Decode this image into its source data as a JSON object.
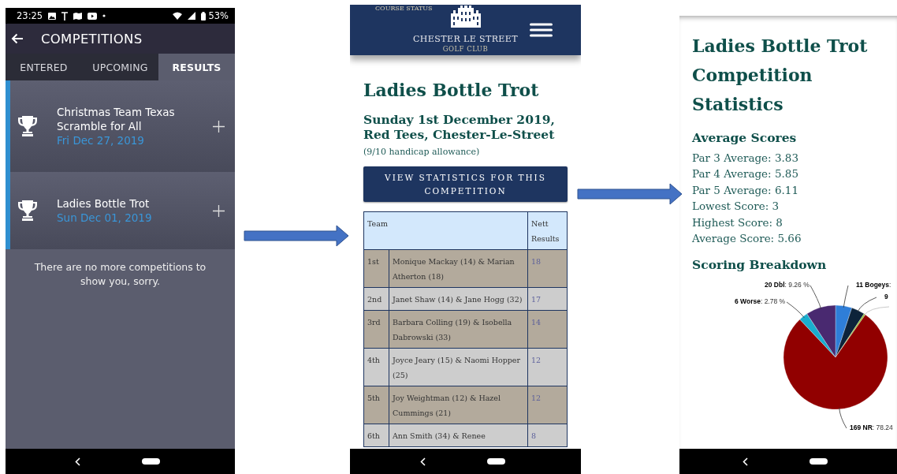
{
  "app_screen": {
    "status_bar": {
      "time": "23:25",
      "battery": "53%"
    },
    "app_bar": {
      "title": "COMPETITIONS"
    },
    "tabs": [
      {
        "label": "ENTERED",
        "selected": false
      },
      {
        "label": "UPCOMING",
        "selected": false
      },
      {
        "label": "RESULTS",
        "selected": true
      }
    ],
    "competitions": [
      {
        "name": "Christmas Team Texas Scramble for All",
        "date": "Fri Dec 27, 2019"
      },
      {
        "name": "Ladies Bottle Trot",
        "date": "Sun Dec 01, 2019"
      }
    ],
    "empty_message": "There are no more competitions to show you, sorry."
  },
  "results_page": {
    "header": {
      "course_status": "COURSE STATUS",
      "club_name": "CHESTER LE STREET",
      "club_subtitle": "GOLF CLUB"
    },
    "title": "Ladies Bottle Trot",
    "subtitle": "Sunday 1st December 2019, Red Tees, Chester-Le-Street",
    "note": "(9/10 handicap allowance)",
    "stats_button": "VIEW STATISTICS FOR THIS COMPETITION",
    "table": {
      "columns": [
        "Team",
        "Nett Results"
      ],
      "rows": [
        {
          "position": "1st",
          "team": "Monique Mackay (14) & Marian Atherton (18)",
          "result": "18"
        },
        {
          "position": "2nd",
          "team": "Janet Shaw (14) & Jane Hogg (32)",
          "result": "17"
        },
        {
          "position": "3rd",
          "team": "Barbara Colling (19) & Isobella Dabrowski (33)",
          "result": "14"
        },
        {
          "position": "4th",
          "team": "Joyce Jeary (15) & Naomi Hopper (25)",
          "result": "12"
        },
        {
          "position": "5th",
          "team": "Joy Weightman (12) & Hazel Cummings (21)",
          "result": "12"
        },
        {
          "position": "6th",
          "team": "Ann Smith (34) & Renee",
          "result": "8"
        }
      ]
    }
  },
  "statistics_page": {
    "title": "Ladies Bottle Trot Competition Statistics",
    "averages_heading": "Average Scores",
    "averages": [
      "Par 3 Average: 3.83",
      "Par 4 Average: 5.85",
      "Par 5 Average: 6.11",
      "Lowest Score: 3",
      "Highest Score: 8",
      "Average Score: 5.66"
    ],
    "breakdown_heading": "Scoring Breakdown",
    "chart_data": {
      "type": "pie",
      "values": [
        11,
        9,
        1,
        169,
        6,
        20
      ],
      "colors": [
        "#2f7ed8",
        "#0d233a",
        "#8bbc21",
        "#910000",
        "#1aadce",
        "#492970"
      ],
      "value_labels": [
        "**11 Bogeys**:",
        "**9**",
        null,
        "**169 NR**: 78.24",
        "**6 Worse**: 2.78 %",
        "**20 Dbl**: 9.26 %"
      ]
    }
  }
}
